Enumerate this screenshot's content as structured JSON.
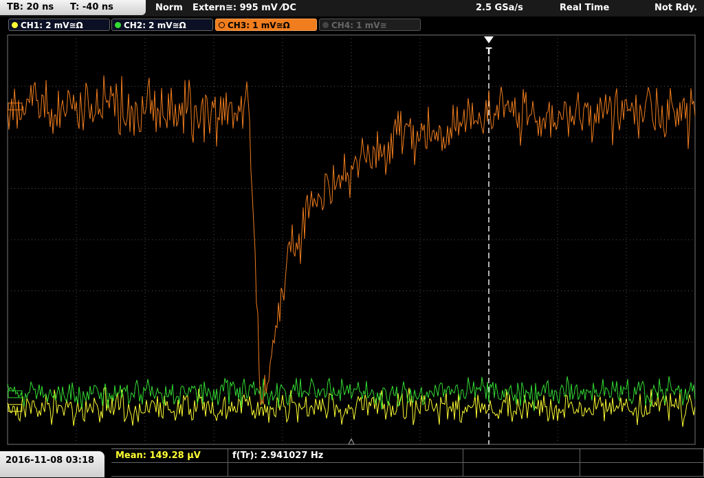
{
  "timebase": {
    "tb": "TB: 20 ns",
    "trig_time": "T: -40 ns"
  },
  "status": {
    "mode": "Norm",
    "trigger": "Extern≅: 995 mV ⁄DC",
    "sample_rate": "2.5 GSa/s",
    "acquisition": "Real Time",
    "state": "Not Rdy."
  },
  "channels": [
    {
      "label": "CH1: 2 mV≅Ω",
      "color": "#ffff33",
      "active": false,
      "enabled": true
    },
    {
      "label": "CH2: 2 mV≅Ω",
      "color": "#33dd33",
      "active": false,
      "enabled": true
    },
    {
      "label": "CH3: 1 mV≅Ω",
      "color": "#f07d1e",
      "active": true,
      "enabled": true
    },
    {
      "label": "CH4: 1 mV≅",
      "color": "#666666",
      "active": false,
      "enabled": false
    }
  ],
  "footer": {
    "datetime": "2016-11-08 03:18",
    "mean_label": "Mean: 149.28 µV",
    "freq_label": "f(Tr): 2.941027 Hz"
  },
  "markers": {
    "trigger": "T"
  },
  "colors": {
    "ch1": "#ffff33",
    "ch2": "#33dd33",
    "ch3": "#f07d1e",
    "grid": "#555555"
  }
}
